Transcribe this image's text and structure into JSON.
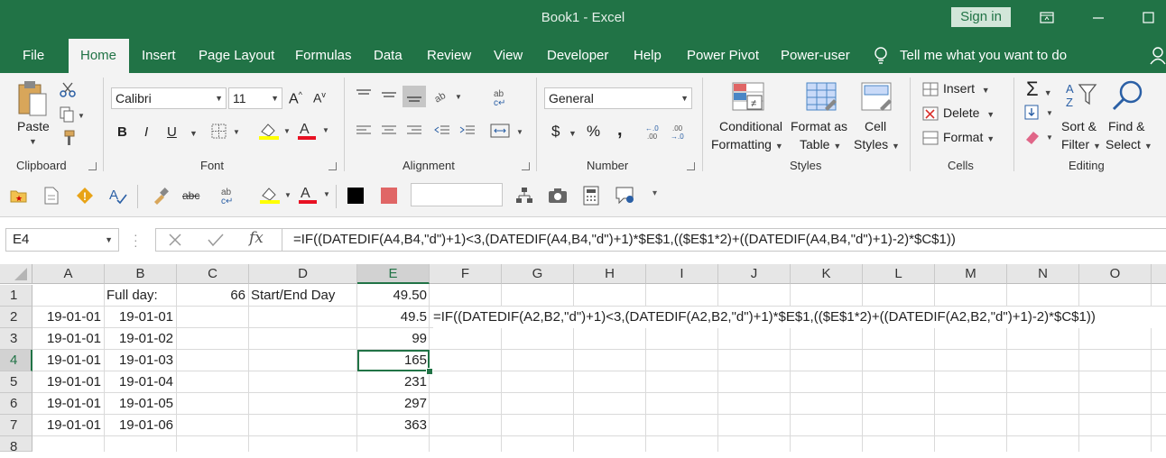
{
  "title": "Book1  -  Excel",
  "sign_in": "Sign in",
  "tabs": [
    "File",
    "Home",
    "Insert",
    "Page Layout",
    "Formulas",
    "Data",
    "Review",
    "View",
    "Developer",
    "Help",
    "Power Pivot",
    "Power-user"
  ],
  "tell_me": "Tell me what you want to do",
  "ribbon": {
    "clipboard": {
      "label": "Clipboard",
      "paste": "Paste"
    },
    "font": {
      "label": "Font",
      "name": "Calibri",
      "size": "11",
      "bold": "B",
      "italic": "I",
      "underline": "U"
    },
    "alignment": {
      "label": "Alignment"
    },
    "number": {
      "label": "Number",
      "format": "General",
      "currency": "$",
      "percent": "%",
      "comma": ","
    },
    "styles": {
      "label": "Styles",
      "conditional": [
        "Conditional",
        "Formatting"
      ],
      "format_table": [
        "Format as",
        "Table"
      ],
      "cell_styles": [
        "Cell",
        "Styles"
      ]
    },
    "cells": {
      "label": "Cells",
      "insert": "Insert",
      "delete": "Delete",
      "format": "Format"
    },
    "editing": {
      "label": "Editing",
      "sort": [
        "Sort &",
        "Filter"
      ],
      "find": [
        "Find &",
        "Select"
      ],
      "sum": "Σ"
    }
  },
  "name_box": "E4",
  "fx": "fx",
  "formula": "=IF((DATEDIF(A4,B4,\"d\")+1)<3,(DATEDIF(A4,B4,\"d\")+1)*$E$1,(($E$1*2)+((DATEDIF(A4,B4,\"d\")+1)-2)*$C$1))",
  "columns": [
    "A",
    "B",
    "C",
    "D",
    "E",
    "F",
    "G",
    "H",
    "I",
    "J",
    "K",
    "L",
    "M",
    "N",
    "O"
  ],
  "rows": [
    "1",
    "2",
    "3",
    "4",
    "5",
    "6",
    "7",
    "8"
  ],
  "cells": {
    "B1": "Full day:",
    "C1": "66",
    "D1": "Start/End Day",
    "E1": "49.50",
    "A2": "19-01-01",
    "B2": "19-01-01",
    "E2": "49.5",
    "F2": "=IF((DATEDIF(A2,B2,\"d\")+1)<3,(DATEDIF(A2,B2,\"d\")+1)*$E$1,(($E$1*2)+((DATEDIF(A2,B2,\"d\")+1)-2)*$C$1))",
    "A3": "19-01-01",
    "B3": "19-01-02",
    "E3": "99",
    "A4": "19-01-01",
    "B4": "19-01-03",
    "E4": "165",
    "A5": "19-01-01",
    "B5": "19-01-04",
    "E5": "231",
    "A6": "19-01-01",
    "B6": "19-01-05",
    "E6": "297",
    "A7": "19-01-01",
    "B7": "19-01-06",
    "E7": "363"
  },
  "colors": {
    "accent": "#217346",
    "ribbon_bg": "#f3f3f3",
    "font_color_red": "#e81123",
    "highlight_yellow": "#ffff00"
  }
}
